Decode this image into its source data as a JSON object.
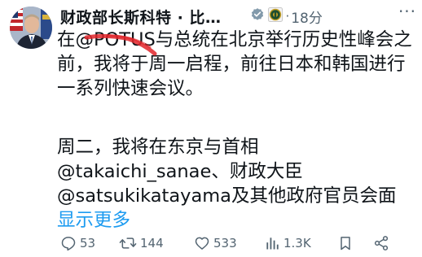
{
  "post": {
    "author": {
      "name": "财政部长斯科特 · 比…"
    },
    "timestamp": "18分",
    "more_label": "···",
    "paragraphs": [
      {
        "text_before": "在",
        "mention": "@POTUS",
        "text_after": "与总统在北京举行历史性峰会之前，我将于周一启程，前往日本和韩国进行一系列快速会议。"
      },
      {
        "text_before": "周二，我将在东京与首相",
        "mention1": "@takaichi_sanae",
        "text_middle": "、财政大臣",
        "mention2": "@satsukikatayama",
        "text_after": "及其他政府官员会面 ",
        "show_more": "显示更多"
      }
    ],
    "actions": {
      "reply_count": "53",
      "repost_count": "144",
      "like_count": "533",
      "view_count": "1.3K"
    },
    "icons": {
      "verified": "verified-badge-icon",
      "affiliate": "affiliate-seal-icon",
      "reply": "reply-icon",
      "repost": "repost-icon",
      "like": "heart-icon",
      "views": "views-icon",
      "bookmark": "bookmark-icon",
      "share": "share-icon"
    },
    "colors": {
      "accent": "#1d9bf0",
      "text": "#0f1419",
      "muted": "#536471",
      "verified_gray": "#829aab",
      "scribble": "#e0242a"
    }
  }
}
